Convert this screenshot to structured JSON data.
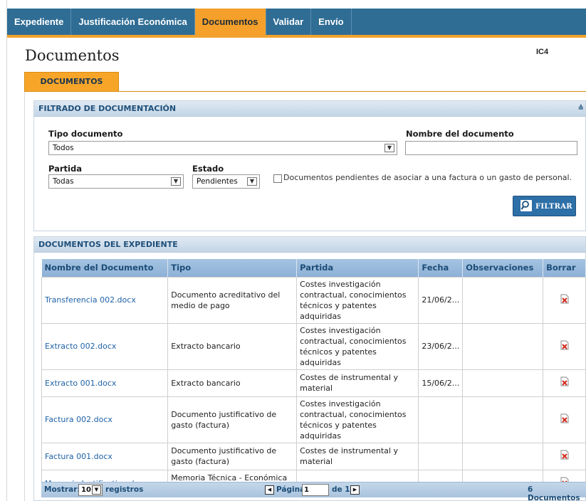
{
  "nav": {
    "items": [
      {
        "label": "Expediente",
        "active": false
      },
      {
        "label": "Justificación Económica",
        "active": false
      },
      {
        "label": "Documentos",
        "active": true
      },
      {
        "label": "Validar",
        "active": false
      },
      {
        "label": "Envío",
        "active": false
      }
    ]
  },
  "page": {
    "title": "Documentos",
    "code": "IC4"
  },
  "tab": {
    "label": "DOCUMENTOS"
  },
  "filter": {
    "header": "FILTRADO DE DOCUMENTACIÓN",
    "tipo_label": "Tipo documento",
    "tipo_value": "Todos",
    "nombre_label": "Nombre del documento",
    "nombre_value": "",
    "partida_label": "Partida",
    "partida_value": "Todas",
    "estado_label": "Estado",
    "estado_value": "Pendientes",
    "checkbox_label": "Documentos pendientes de asociar a una factura o un gasto de personal.",
    "checkbox_checked": false,
    "button_label": "FILTRAR"
  },
  "docs": {
    "header": "DOCUMENTOS DEL EXPEDIENTE",
    "columns": [
      "Nombre del Documento",
      "Tipo",
      "Partida",
      "Fecha",
      "Observaciones",
      "Borrar"
    ],
    "rows": [
      {
        "name": "Transferencia 002.docx",
        "tipo": "Documento acreditativo del medio de pago",
        "partida": "Costes investigación contractual, conocimientos técnicos y patentes adquiridas",
        "fecha": "21/06/2...",
        "obs": ""
      },
      {
        "name": "Extracto 002.docx",
        "tipo": "Extracto bancario",
        "partida": "Costes investigación contractual, conocimientos técnicos y patentes adquiridas",
        "fecha": "23/06/2...",
        "obs": ""
      },
      {
        "name": "Extracto 001.docx",
        "tipo": "Extracto bancario",
        "partida": "Costes de instrumental y material",
        "fecha": "15/06/2...",
        "obs": ""
      },
      {
        "name": "Factura 002.docx",
        "tipo": "Documento justificativo de gasto (factura)",
        "partida": "Costes investigación contractual, conocimientos técnicos y patentes adquiridas",
        "fecha": "",
        "obs": ""
      },
      {
        "name": "Factura 001.docx",
        "tipo": "Documento justificativo de gasto (factura)",
        "partida": "Costes de instrumental y material",
        "fecha": "",
        "obs": ""
      },
      {
        "name": "Memoria Justificativa.docx",
        "tipo": "Memoria Técnica - Económica Justificativa",
        "partida": "",
        "fecha": "",
        "obs": ""
      }
    ]
  },
  "footer": {
    "mostrar_label": "Mostrar:",
    "page_size": "10",
    "registros_label": "registros",
    "pagina_label": "Página",
    "page_value": "1",
    "de_label": "de 1",
    "total_label": "6 Documentos"
  },
  "colors": {
    "nav_bg": "#2f6d94",
    "accent": "#f5a02a",
    "link": "#1f62a6"
  },
  "icons": {
    "delete": "delete-doc-icon",
    "search": "magnifier-icon"
  }
}
